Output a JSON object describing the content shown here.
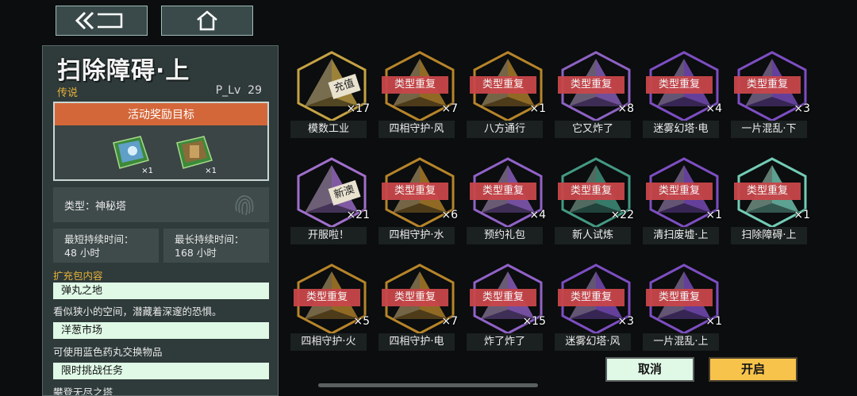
{
  "colors": {
    "accent": "#f7c34a",
    "badge": "#c8464a",
    "legendary": "#e4b23a",
    "orange": "#d4673a"
  },
  "nav": {
    "back_icon": "back-icon",
    "home_icon": "home-icon"
  },
  "panel": {
    "title": "扫除障碍·上",
    "rarity": "传说",
    "plv_label": "P_Lv",
    "plv_value": "29",
    "reward_title": "活动奖励目标",
    "rewards": [
      {
        "count": "×1"
      },
      {
        "count": "×1"
      }
    ],
    "type_label": "类型：神秘塔",
    "min_label": "最短持续时间：",
    "min_value": "48 小时",
    "max_label": "最长持续时间：",
    "max_value": "168 小时",
    "pack_title": "扩充包内容",
    "packs": [
      {
        "name": "弹丸之地",
        "desc": "看似狭小的空间，潜藏着深邃的恐惧。"
      },
      {
        "name": "洋葱市场",
        "desc": "可使用蓝色药丸交换物品"
      },
      {
        "name": "限时挑战任务",
        "desc": "攀登无尽之塔"
      }
    ]
  },
  "badge_text": "类型重复",
  "items": [
    {
      "name": "模数工业",
      "count": "×17",
      "color": "#d9b24a",
      "dup": false,
      "tag": "充值"
    },
    {
      "name": "四相守护·风",
      "count": "×7",
      "color": "#c9912e",
      "dup": true
    },
    {
      "name": "八方通行",
      "count": "×1",
      "color": "#c9912e",
      "dup": true
    },
    {
      "name": "它又炸了",
      "count": "×8",
      "color": "#9b6bd6",
      "dup": true
    },
    {
      "name": "迷雾幻塔·电",
      "count": "×4",
      "color": "#8a55d6",
      "dup": true
    },
    {
      "name": "一片混乱·下",
      "count": "×3",
      "color": "#8a55d6",
      "dup": true
    },
    {
      "name": "开服啦！",
      "count": "×21",
      "color": "#b07ae0",
      "dup": false,
      "tag": "新澳"
    },
    {
      "name": "四相守护·水",
      "count": "×6",
      "color": "#c9912e",
      "dup": true
    },
    {
      "name": "预约礼包",
      "count": "×4",
      "color": "#a06cdc",
      "dup": true
    },
    {
      "name": "新人试炼",
      "count": "×22",
      "color": "#4aa890",
      "dup": true
    },
    {
      "name": "清扫废墟·上",
      "count": "×1",
      "color": "#8a55d6",
      "dup": true
    },
    {
      "name": "扫除障碍·上",
      "count": "×1",
      "color": "#7ee0c8",
      "dup": true
    },
    {
      "name": "四相守护·火",
      "count": "×5",
      "color": "#c9912e",
      "dup": true
    },
    {
      "name": "四相守护·电",
      "count": "×7",
      "color": "#c9912e",
      "dup": true
    },
    {
      "name": "炸了炸了",
      "count": "×15",
      "color": "#a06cdc",
      "dup": true
    },
    {
      "name": "迷雾幻塔·风",
      "count": "×3",
      "color": "#8a55d6",
      "dup": true
    },
    {
      "name": "一片混乱·上",
      "count": "×1",
      "color": "#8a55d6",
      "dup": true
    }
  ],
  "buttons": {
    "cancel": "取消",
    "open": "开启"
  }
}
